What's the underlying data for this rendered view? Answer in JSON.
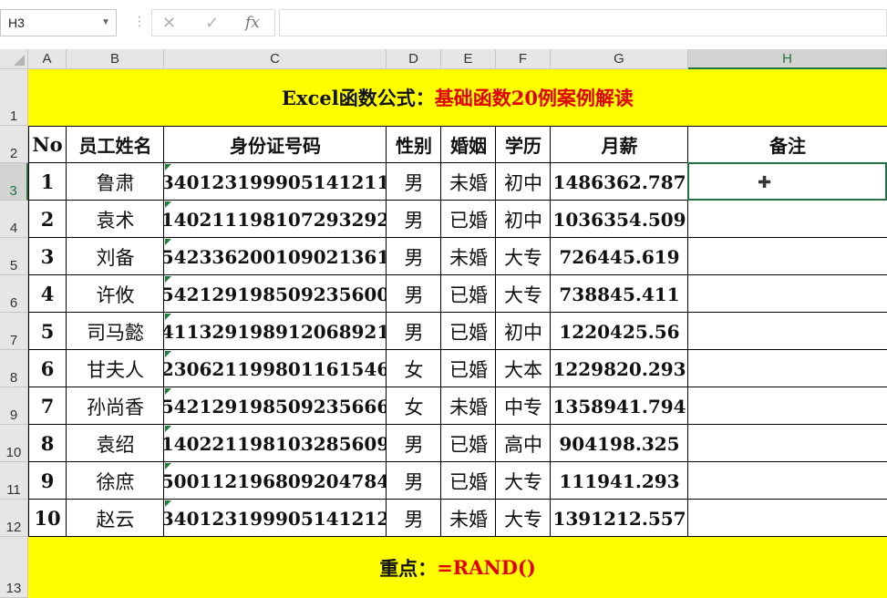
{
  "name_box": {
    "value": "H3",
    "dropdown_icon": "chevron-down-icon"
  },
  "formula_bar": {
    "separator": "⋮",
    "cancel_icon": "✕",
    "enter_icon": "✓",
    "fx_label": "fx",
    "formula": ""
  },
  "columns": [
    "A",
    "B",
    "C",
    "D",
    "E",
    "F",
    "G",
    "H"
  ],
  "rows": [
    "1",
    "2",
    "3",
    "4",
    "5",
    "6",
    "7",
    "8",
    "9",
    "10",
    "11",
    "12",
    "13"
  ],
  "title": {
    "black": "Excel函数公式：",
    "red": "基础函数20例案例解读"
  },
  "headers": [
    "No",
    "员工姓名",
    "身份证号码",
    "性别",
    "婚姻",
    "学历",
    "月薪",
    "备注"
  ],
  "records": [
    [
      "1",
      "鲁肃",
      "340123199905141211",
      "男",
      "未婚",
      "初中",
      "1486362.787",
      ""
    ],
    [
      "2",
      "袁术",
      "140211198107293292",
      "男",
      "已婚",
      "初中",
      "1036354.509",
      ""
    ],
    [
      "3",
      "刘备",
      "542336200109021361",
      "男",
      "未婚",
      "大专",
      "726445.619",
      ""
    ],
    [
      "4",
      "许攸",
      "542129198509235600",
      "男",
      "已婚",
      "大专",
      "738845.411",
      ""
    ],
    [
      "5",
      "司马懿",
      "411329198912068921",
      "男",
      "已婚",
      "初中",
      "1220425.56",
      ""
    ],
    [
      "6",
      "甘夫人",
      "230621199801161546",
      "女",
      "已婚",
      "大本",
      "1229820.293",
      ""
    ],
    [
      "7",
      "孙尚香",
      "542129198509235666",
      "女",
      "未婚",
      "中专",
      "1358941.794",
      ""
    ],
    [
      "8",
      "袁绍",
      "140221198103285609",
      "男",
      "已婚",
      "高中",
      "904198.325",
      ""
    ],
    [
      "9",
      "徐庶",
      "500112196809204784",
      "男",
      "已婚",
      "大专",
      "111941.293",
      ""
    ],
    [
      "10",
      "赵云",
      "340123199905141212",
      "男",
      "未婚",
      "大专",
      "1391212.557",
      ""
    ]
  ],
  "footer": {
    "black": "重点：",
    "red": "=RAND()"
  },
  "colors": {
    "band": "#ffff00",
    "accent_red": "#e00000",
    "selection_green": "#217346"
  },
  "active_cell": "H3",
  "cursor_icon": "plus-cursor-icon"
}
